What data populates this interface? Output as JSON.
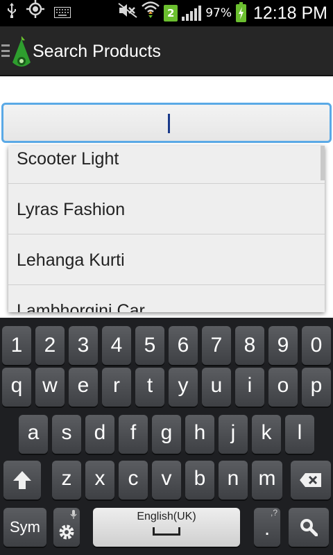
{
  "status_bar": {
    "battery_percent": "97%",
    "time": "12:18 PM",
    "sim_slot": "2",
    "icons": [
      "usb-icon",
      "gps-icon",
      "keyboard-icon",
      "mute-icon",
      "wifi-icon",
      "signal-icon",
      "battery-icon"
    ]
  },
  "action_bar": {
    "title": "Search Products",
    "accent_color": "#2e9e2e"
  },
  "search": {
    "value": "",
    "focus_color": "#5aa9e6"
  },
  "suggestions": [
    {
      "label": "Scooter Light"
    },
    {
      "label": "Lyras Fashion"
    },
    {
      "label": "Lehanga Kurti"
    },
    {
      "label": "Lambhorgini Car"
    }
  ],
  "keyboard": {
    "numbers": [
      "1",
      "2",
      "3",
      "4",
      "5",
      "6",
      "7",
      "8",
      "9",
      "0"
    ],
    "row1": [
      "q",
      "w",
      "e",
      "r",
      "t",
      "y",
      "u",
      "i",
      "o",
      "p"
    ],
    "row2": [
      "a",
      "s",
      "d",
      "f",
      "g",
      "h",
      "j",
      "k",
      "l"
    ],
    "row3": [
      "z",
      "x",
      "c",
      "v",
      "b",
      "n",
      "m"
    ],
    "sym_label": "Sym",
    "space_label": "English(UK)",
    "dot_label": ".",
    "dot_hint": ",?"
  }
}
